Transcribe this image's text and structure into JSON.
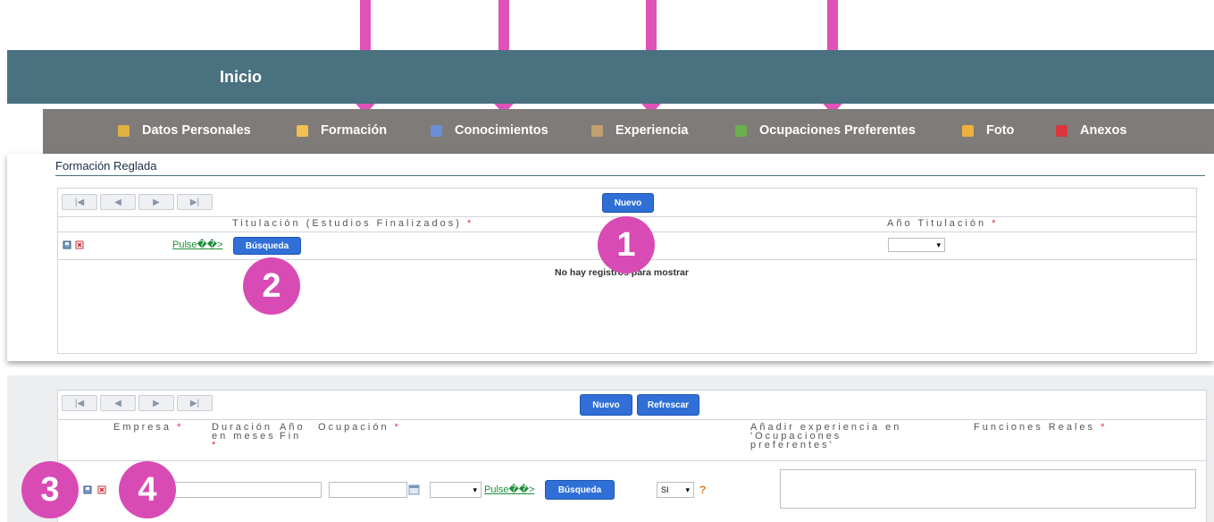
{
  "header": {
    "title": "Inicio"
  },
  "nav": {
    "items": [
      {
        "label": "Datos Personales",
        "icon": "user-card-icon",
        "color": "#e0b040"
      },
      {
        "label": "Formación",
        "icon": "pencil-icon",
        "color": "#f0c050"
      },
      {
        "label": "Conocimientos",
        "icon": "book-icon",
        "color": "#6a8fd6"
      },
      {
        "label": "Experiencia",
        "icon": "worker-icon",
        "color": "#c0a070"
      },
      {
        "label": "Ocupaciones Preferentes",
        "icon": "briefcase-add-icon",
        "color": "#6ab04c"
      },
      {
        "label": "Foto",
        "icon": "photo-icon",
        "color": "#f0b040"
      },
      {
        "label": "Anexos",
        "icon": "attachment-icon",
        "color": "#d9363e"
      }
    ]
  },
  "formacion": {
    "section_title": "Formación Reglada",
    "new_button": "Nuevo",
    "col_titulacion": "Titulación (Estudios Finalizados)",
    "col_anio": "Año Titulación",
    "required_mark": "*",
    "pulse_link": "Pulse��>",
    "search_button": "Búsqueda",
    "empty_message": "No hay registros para mostrar"
  },
  "experiencia": {
    "new_button": "Nuevo",
    "refresh_button": "Refrescar",
    "col_empresa": "Empresa",
    "col_duracion": "Duración\nen meses",
    "col_anio_fin": "Año\nFin",
    "col_ocupacion": "Ocupación",
    "col_anadir": "Añadir experiencia en\n'Ocupaciones\npreferentes'",
    "col_funciones": "Funciones Reales",
    "required_mark": "*",
    "pulse_link": "Pulse��>",
    "search_button": "Búsqueda",
    "si_value": "SI",
    "help_mark": "?"
  },
  "badges": [
    "1",
    "2",
    "3",
    "4"
  ],
  "pager": {
    "first": "|◀",
    "prev": "◀",
    "next": "▶",
    "last": "▶|"
  },
  "colors": {
    "accent_pink": "#e052b8",
    "topbar": "#4a7180",
    "navbar": "#7f7b78",
    "button_blue": "#2f6fd6"
  }
}
